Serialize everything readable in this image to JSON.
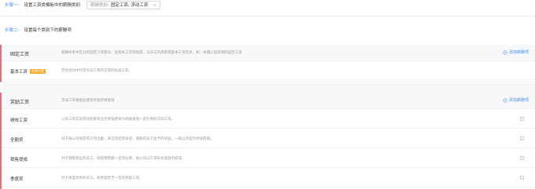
{
  "step1": {
    "label": "步骤一:",
    "text": "设置工资类模板中的薪酬类别",
    "select_label": "薪酬类别:",
    "select_value": "固定工资, 浮动工资"
  },
  "step2": {
    "label": "步骤二:",
    "text": "设置每个类别下的薪酬项"
  },
  "fixed": {
    "title": "固定工资",
    "desc": "薪酬体系中区分的固定工资部分，含基本工资等组成，与员工的月薪或基本工资无关，如：本期以前周期的固定工资",
    "add_label": "添加薪酬项",
    "items": [
      {
        "name": "基本工资",
        "badge": "系统内置",
        "desc": "劳动合同中约定的员工每月应得的标准工资。"
      }
    ]
  },
  "bonus": {
    "title": "奖励工资",
    "desc": "浮动工资根据业绩等考核结果发放",
    "add_label": "添加薪酬项",
    "items": [
      {
        "name": "绩效工资",
        "desc": "以员工的实际劳动成果或业务考核结果为依据发放一定比例的浮动工资。"
      },
      {
        "name": "全勤奖",
        "desc": "对于按公司规定的工时出勤、未出现迟到早退、请假的员工给予的奖励，一般以月度为考核周期。"
      },
      {
        "name": "销售提成",
        "desc": "对于销售岗位的员工，按照销售额一定的比例，由公司以工资形式发放的提成。"
      },
      {
        "name": "季度奖",
        "desc": "对于季度优秀的员工，按季度给予一定的奖励工资。"
      }
    ]
  },
  "colors": {
    "accent": "#4a90e2",
    "section_border": "#e0707a",
    "badge": "#f5a623"
  }
}
